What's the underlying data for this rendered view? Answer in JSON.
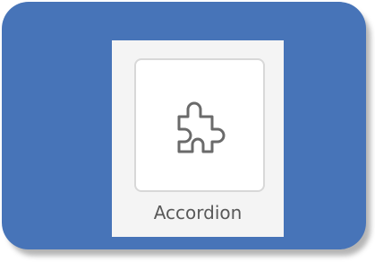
{
  "widget_tile": {
    "label": "Accordion",
    "icon": "puzzle-piece-icon"
  },
  "colors": {
    "frame_background": "#4774b8",
    "panel_background": "#f4f4f4",
    "tile_border": "#d8d8d8",
    "label_text": "#595959"
  }
}
